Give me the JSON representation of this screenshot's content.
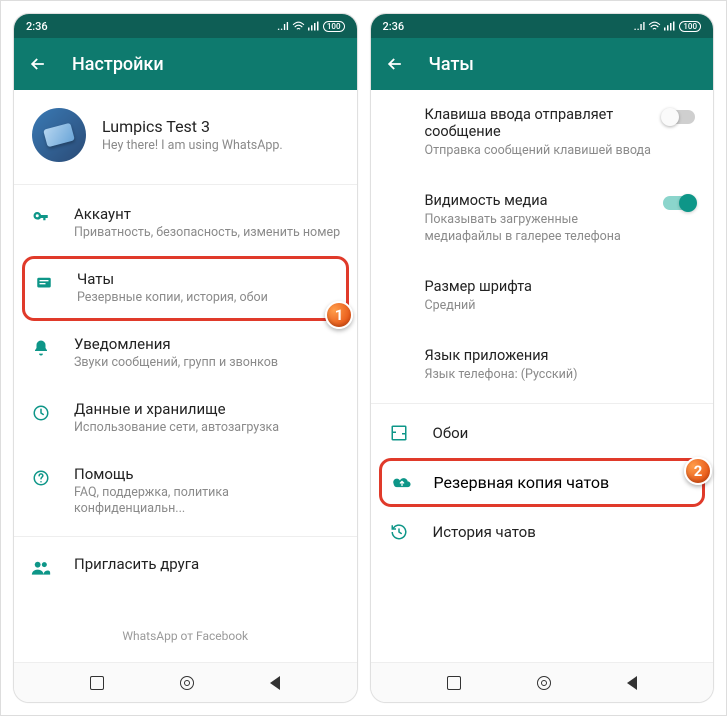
{
  "statusbar": {
    "time": "2:36",
    "battery": "100"
  },
  "left": {
    "appbar_title": "Настройки",
    "profile": {
      "name": "Lumpics Test 3",
      "status": "Hey there! I am using WhatsApp."
    },
    "items": {
      "account": {
        "title": "Аккаунт",
        "sub": "Приватность, безопасность, изменить номер"
      },
      "chats": {
        "title": "Чаты",
        "sub": "Резервные копии, история, обои"
      },
      "notifications": {
        "title": "Уведомления",
        "sub": "Звуки сообщений, групп и звонков"
      },
      "data": {
        "title": "Данные и хранилище",
        "sub": "Использование сети, автозагрузка"
      },
      "help": {
        "title": "Помощь",
        "sub": "FAQ, поддержка, политика конфиденциальн..."
      },
      "invite": {
        "title": "Пригласить друга"
      }
    },
    "footer": "WhatsApp от Facebook"
  },
  "right": {
    "appbar_title": "Чаты",
    "settings": {
      "enter_send": {
        "title": "Клавиша ввода отправляет сообщение",
        "sub": "Отправка сообщений клавишей ввода"
      },
      "media_vis": {
        "title": "Видимость медиа",
        "sub": "Показывать загруженные медиафайлы в галерее телефона"
      },
      "font_size": {
        "title": "Размер шрифта",
        "sub": "Средний"
      },
      "app_lang": {
        "title": "Язык приложения",
        "sub": "Язык телефона: (Русский)"
      }
    },
    "rows": {
      "wallpaper": "Обои",
      "backup": "Резервная копия чатов",
      "history": "История чатов"
    }
  },
  "badges": {
    "one": "1",
    "two": "2"
  }
}
